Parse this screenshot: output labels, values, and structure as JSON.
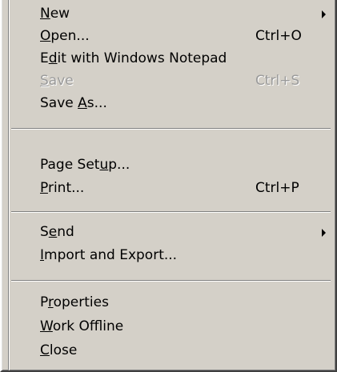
{
  "menu": {
    "items": [
      {
        "pre": "",
        "mn": "N",
        "post": "ew",
        "shortcut": "",
        "submenu": true,
        "enabled": true
      },
      {
        "pre": "",
        "mn": "O",
        "post": "pen...",
        "shortcut": "Ctrl+O",
        "submenu": false,
        "enabled": true
      },
      {
        "pre": "E",
        "mn": "d",
        "post": "it with Windows Notepad",
        "shortcut": "",
        "submenu": false,
        "enabled": true
      },
      {
        "pre": "",
        "mn": "S",
        "post": "ave",
        "shortcut": "Ctrl+S",
        "submenu": false,
        "enabled": false
      },
      {
        "pre": "Save ",
        "mn": "A",
        "post": "s...",
        "shortcut": "",
        "submenu": false,
        "enabled": true
      },
      {
        "pre": "Page Set",
        "mn": "u",
        "post": "p...",
        "shortcut": "",
        "submenu": false,
        "enabled": true
      },
      {
        "pre": "",
        "mn": "P",
        "post": "rint...",
        "shortcut": "Ctrl+P",
        "submenu": false,
        "enabled": true
      },
      {
        "pre": "S",
        "mn": "e",
        "post": "nd",
        "shortcut": "",
        "submenu": true,
        "enabled": true
      },
      {
        "pre": "",
        "mn": "I",
        "post": "mport and Export...",
        "shortcut": "",
        "submenu": false,
        "enabled": true
      },
      {
        "pre": "P",
        "mn": "r",
        "post": "operties",
        "shortcut": "",
        "submenu": false,
        "enabled": true
      },
      {
        "pre": "",
        "mn": "W",
        "post": "ork Offline",
        "shortcut": "",
        "submenu": false,
        "enabled": true
      },
      {
        "pre": "",
        "mn": "C",
        "post": "lose",
        "shortcut": "",
        "submenu": false,
        "enabled": true
      }
    ]
  },
  "colors": {
    "menu_background": "#d4d0c8",
    "disabled_text": "#9a9a9a"
  }
}
